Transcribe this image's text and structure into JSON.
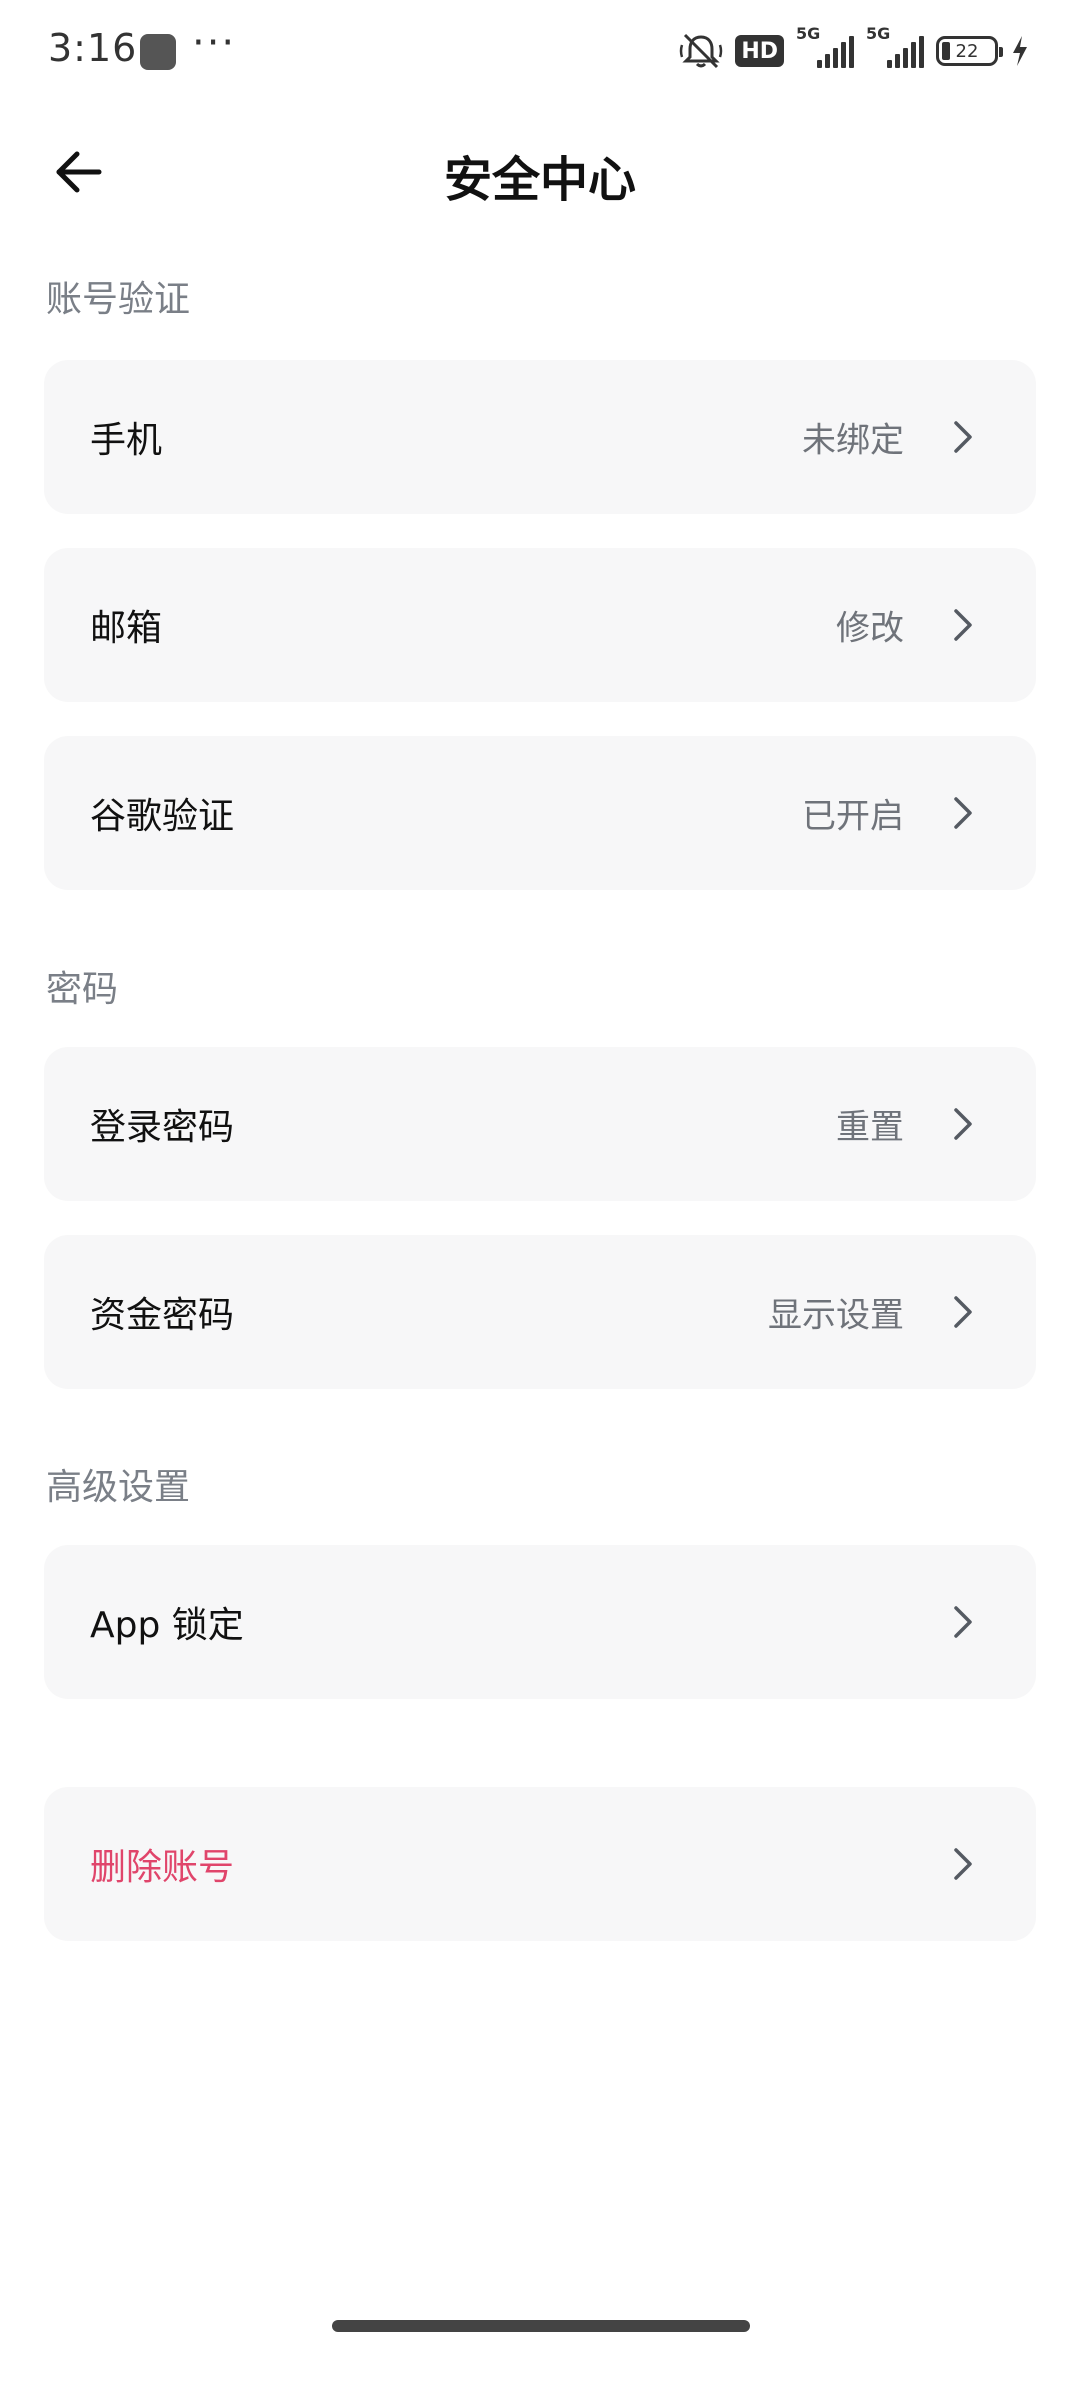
{
  "status_bar": {
    "time": "3:16",
    "more": "···",
    "hd_label": "HD",
    "signal1_label": "5G",
    "signal2_label": "5G",
    "battery_level": "22",
    "icons": [
      "app-notification-icon",
      "mute-icon",
      "hd-icon",
      "signal-5g-icon",
      "signal-5g-icon",
      "battery-icon",
      "charging-icon"
    ]
  },
  "header": {
    "title": "安全中心",
    "back_icon": "back-arrow-icon"
  },
  "sections": {
    "account": {
      "label": "账号验证",
      "items": [
        {
          "label": "手机",
          "value": "未绑定"
        },
        {
          "label": "邮箱",
          "value": "修改"
        },
        {
          "label": "谷歌验证",
          "value": "已开启"
        }
      ]
    },
    "password": {
      "label": "密码",
      "items": [
        {
          "label": "登录密码",
          "value": "重置"
        },
        {
          "label": "资金密码",
          "value": "显示设置"
        }
      ]
    },
    "advanced": {
      "label": "高级设置",
      "items": [
        {
          "label": "App 锁定",
          "value": ""
        }
      ]
    },
    "danger": {
      "items": [
        {
          "label": "删除账号",
          "value": ""
        }
      ]
    }
  },
  "colors": {
    "danger": "#e0456b",
    "card_bg": "#f7f7f8",
    "secondary_text": "#6f737a"
  }
}
